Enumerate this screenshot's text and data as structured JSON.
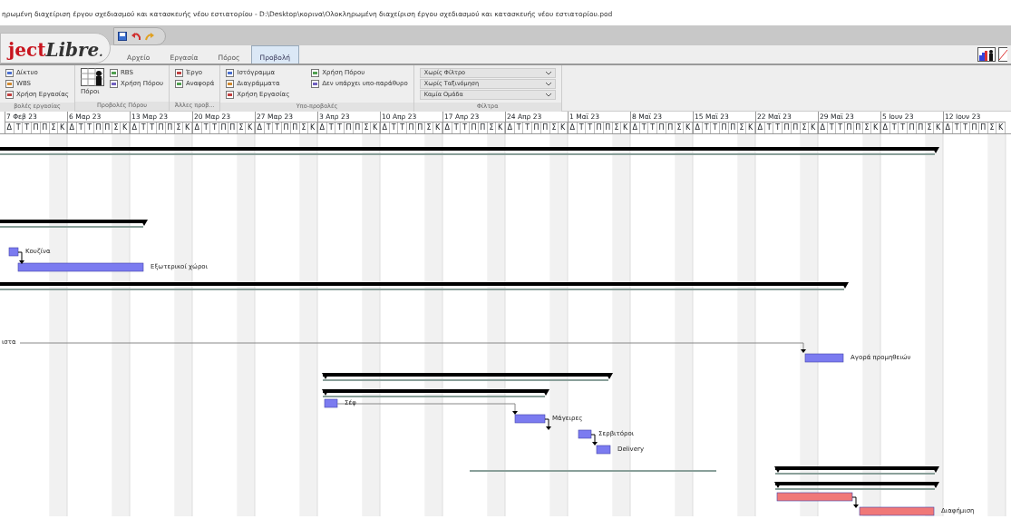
{
  "window": {
    "title": "ηρωμένη διαχείριση έργου σχεδιασμού και κατασκευής νέου εστιατορίου - D:\\Desktop\\κορινα\\Ολοκληρωμένη διαχείριση έργου σχεδιασμού και κατασκευής νέου εστιατορίου.pod"
  },
  "logo": {
    "part_1": "ject",
    "part_2": "Libre",
    "part_3": "."
  },
  "tabs": [
    {
      "label": "Αρχείο",
      "selected": false
    },
    {
      "label": "Εργασία",
      "selected": false
    },
    {
      "label": "Πόρος",
      "selected": false
    },
    {
      "label": "Προβολή",
      "selected": true
    }
  ],
  "ribbon_groups": [
    {
      "label": "βολές εργασίας",
      "kind": "list",
      "items": [
        "Δίκτυο",
        "WBS",
        "Χρήση Εργασίας"
      ]
    },
    {
      "label": "Προβολές Πόρου",
      "kind": "resource",
      "big": "Πόροι",
      "items": [
        "RBS",
        "Χρήση Πόρου"
      ]
    },
    {
      "label": "Άλλες προβ...",
      "kind": "list",
      "items": [
        "Έργο",
        "Αναφορά"
      ]
    },
    {
      "label": "Υπο-προβολές",
      "kind": "sub",
      "items": [
        "Ιστόγραμμα",
        "Διαγράμματα",
        "Χρήση Εργασίας",
        "Χρήση Πόρου",
        "Δεν υπάρχει υπο-παράθυρο"
      ]
    },
    {
      "label": "Φίλτρα",
      "kind": "filters",
      "items": [
        "Χωρίς Φίλτρο",
        "Χωρίς Ταξινόμηση",
        "Καμία Ομάδα"
      ]
    }
  ],
  "timescale": {
    "weeks": [
      {
        "label": "7 Φεβ 23",
        "days": [
          "Δ",
          "Τ",
          "Τ",
          "Π",
          "Π",
          "Σ",
          "Κ"
        ]
      },
      {
        "label": "6 Μαρ 23",
        "days": [
          "Δ",
          "Τ",
          "Τ",
          "Π",
          "Π",
          "Σ",
          "Κ"
        ]
      },
      {
        "label": "13 Μαρ 23",
        "days": [
          "Δ",
          "Τ",
          "Τ",
          "Π",
          "Π",
          "Σ",
          "Κ"
        ]
      },
      {
        "label": "20 Μαρ 23",
        "days": [
          "Δ",
          "Τ",
          "Τ",
          "Π",
          "Π",
          "Σ",
          "Κ"
        ]
      },
      {
        "label": "27 Μαρ 23",
        "days": [
          "Δ",
          "Τ",
          "Τ",
          "Π",
          "Π",
          "Σ",
          "Κ"
        ]
      },
      {
        "label": "3 Απρ 23",
        "days": [
          "Δ",
          "Τ",
          "Τ",
          "Π",
          "Π",
          "Σ",
          "Κ"
        ]
      },
      {
        "label": "10 Απρ 23",
        "days": [
          "Δ",
          "Τ",
          "Τ",
          "Π",
          "Π",
          "Σ",
          "Κ"
        ]
      },
      {
        "label": "17 Απρ 23",
        "days": [
          "Δ",
          "Τ",
          "Τ",
          "Π",
          "Π",
          "Σ",
          "Κ"
        ]
      },
      {
        "label": "24 Απρ 23",
        "days": [
          "Δ",
          "Τ",
          "Τ",
          "Π",
          "Π",
          "Σ",
          "Κ"
        ]
      },
      {
        "label": "1 Μαϊ 23",
        "days": [
          "Δ",
          "Τ",
          "Τ",
          "Π",
          "Π",
          "Σ",
          "Κ"
        ]
      },
      {
        "label": "8 Μαϊ 23",
        "days": [
          "Δ",
          "Τ",
          "Τ",
          "Π",
          "Π",
          "Σ",
          "Κ"
        ]
      },
      {
        "label": "15 Μαϊ 23",
        "days": [
          "Δ",
          "Τ",
          "Τ",
          "Π",
          "Π",
          "Σ",
          "Κ"
        ]
      },
      {
        "label": "22 Μαϊ 23",
        "days": [
          "Δ",
          "Τ",
          "Τ",
          "Π",
          "Π",
          "Σ",
          "Κ"
        ]
      },
      {
        "label": "29 Μαϊ 23",
        "days": [
          "Δ",
          "Τ",
          "Τ",
          "Π",
          "Π",
          "Σ",
          "Κ"
        ]
      },
      {
        "label": "5 Ιουν 23",
        "days": [
          "Δ",
          "Τ",
          "Τ",
          "Π",
          "Π",
          "Σ",
          "Κ"
        ]
      },
      {
        "label": "12 Ιουν 23",
        "days": [
          "Δ",
          "Τ",
          "Τ",
          "Π",
          "Π",
          "Σ",
          "Κ"
        ]
      }
    ]
  },
  "gantt": [
    {
      "kind": "summary"
    },
    {
      "kind": "summary"
    },
    {
      "kind": "task",
      "label": "Κουζίνα",
      "color": "#7b7bf0"
    },
    {
      "kind": "task",
      "label": "Εξωτερικοί χώροι",
      "color": "#7b7bf0"
    },
    {
      "kind": "summary"
    },
    {
      "kind": "link",
      "label": "ιστα"
    },
    {
      "kind": "task",
      "label": "Αγορά προμηθειών",
      "color": "#7b7bf0"
    },
    {
      "kind": "summary"
    },
    {
      "kind": "summary"
    },
    {
      "kind": "task",
      "label": "Σέφ",
      "color": "#7b7bf0"
    },
    {
      "kind": "task",
      "label": "Μάγειρες",
      "color": "#7b7bf0"
    },
    {
      "kind": "task",
      "label": "Σερβιτόροι",
      "color": "#7b7bf0"
    },
    {
      "kind": "task",
      "label": "Delivery",
      "color": "#7b7bf0"
    },
    {
      "kind": "baseline"
    },
    {
      "kind": "summary"
    },
    {
      "kind": "summary"
    },
    {
      "kind": "task",
      "color": "#f07878"
    },
    {
      "kind": "task",
      "label": "Διαφήμιση",
      "color": "#f07878"
    }
  ]
}
